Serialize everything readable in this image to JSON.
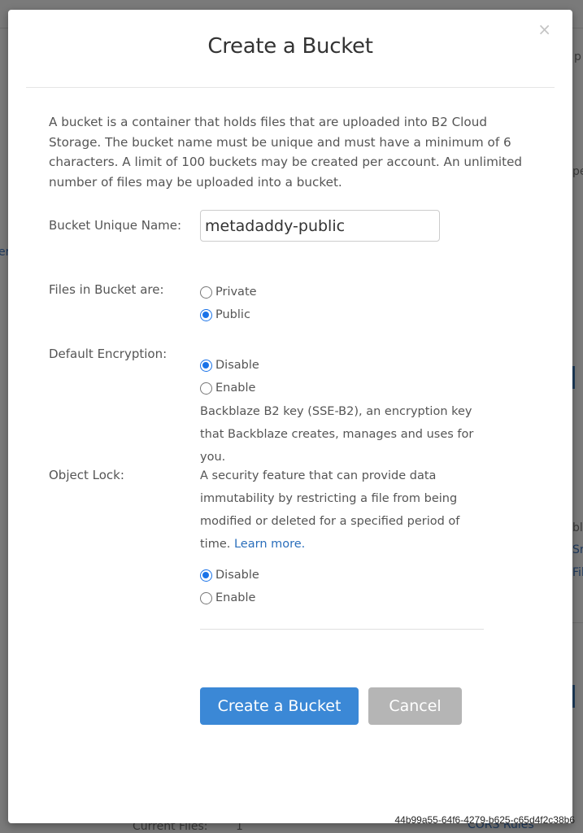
{
  "background": {
    "fragments": {
      "right_top": "p",
      "right_mid": "pe",
      "left_mid": "er",
      "right_lower_1": "ble",
      "right_lower_2": "Sr",
      "right_lower_3": "Fil",
      "bottom_label": "Current Files:",
      "bottom_value": "1",
      "bottom_link": "CORS Rules"
    }
  },
  "modal": {
    "title": "Create a Bucket",
    "close_icon": "×",
    "intro": "A bucket is a container that holds files that are uploaded into B2 Cloud Storage. The bucket name must be unique and must have a minimum of 6 characters. A limit of 100 buckets may be created per account. An unlimited number of files may be uploaded into a bucket.",
    "bucket_name": {
      "label": "Bucket Unique Name:",
      "value": "metadaddy-public",
      "placeholder": ""
    },
    "files_visibility": {
      "label": "Files in Bucket are:",
      "options": [
        {
          "label": "Private",
          "checked": false
        },
        {
          "label": "Public",
          "checked": true
        }
      ]
    },
    "default_encryption": {
      "label": "Default Encryption:",
      "options": [
        {
          "label": "Disable",
          "checked": true
        },
        {
          "label": "Enable",
          "checked": false
        }
      ],
      "help": "Backblaze B2 key (SSE-B2), an encryption key that Backblaze creates, manages and uses for you."
    },
    "object_lock": {
      "label": "Object Lock:",
      "help": "A security feature that can provide data immutability by restricting a file from being modified or deleted for a specified period of time.",
      "learn_more": "Learn more.",
      "options": [
        {
          "label": "Disable",
          "checked": true
        },
        {
          "label": "Enable",
          "checked": false
        }
      ]
    },
    "buttons": {
      "create": "Create a Bucket",
      "cancel": "Cancel"
    }
  },
  "watermark": "44b99a55-64f6-4279-b625-c65d4f2c38b6",
  "colors": {
    "primary": "#3b88d6",
    "cancel": "#b5b5b5",
    "radio_checked": "#1a73e8",
    "link": "#2a6ebb"
  }
}
